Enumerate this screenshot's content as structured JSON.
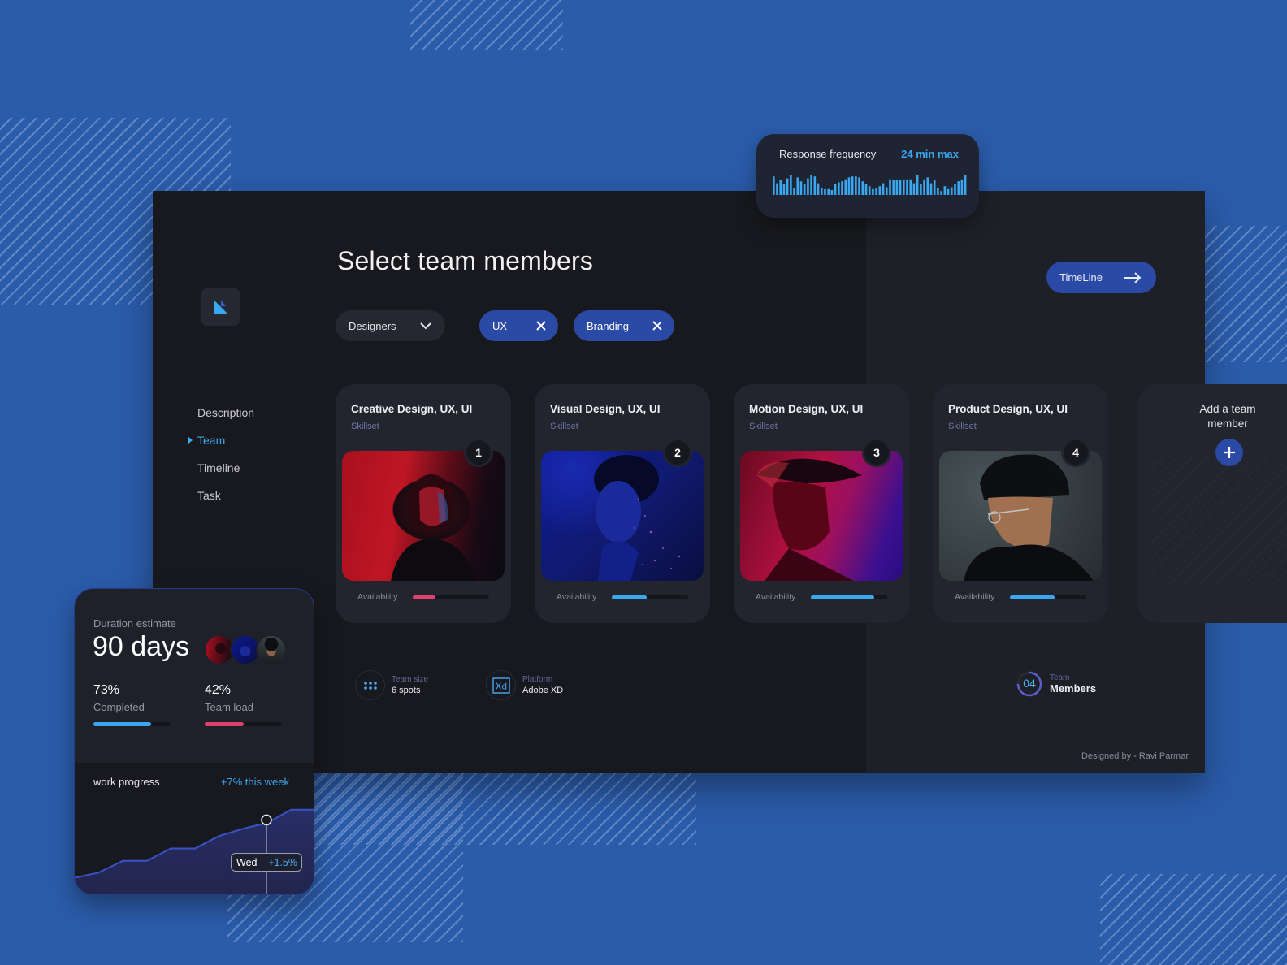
{
  "colors": {
    "background": "#2b5caa",
    "window": "#18191e",
    "card": "#23252e",
    "accent_blue": "#2a4aa5",
    "highlight": "#3aa7f0",
    "pink": "#e0406e"
  },
  "page": {
    "title": "Select team members",
    "credit": "Designed by - Ravi Parmar"
  },
  "logo": {
    "icon": "triangle-logo-icon"
  },
  "filters": {
    "dropdown": {
      "value": "Designers",
      "icon": "chevron-down-icon"
    },
    "chips": [
      {
        "label": "UX",
        "icon": "close-icon"
      },
      {
        "label": "Branding",
        "icon": "close-icon"
      }
    ]
  },
  "timeline_button": {
    "label": "TimeLine",
    "icon": "arrow-right-icon"
  },
  "sidebar": {
    "items": [
      {
        "label": "Description",
        "active": false
      },
      {
        "label": "Team",
        "active": true
      },
      {
        "label": "Timeline",
        "active": false
      },
      {
        "label": "Task",
        "active": false
      }
    ]
  },
  "cards": [
    {
      "title": "Creative Design, UX, UI",
      "subtitle": "Skillset",
      "number": "1",
      "availability_label": "Availability",
      "availability": 0.3,
      "bar_color": "#e0406e",
      "photo": "red-lit-portrait"
    },
    {
      "title": "Visual Design, UX, UI",
      "subtitle": "Skillset",
      "number": "2",
      "availability_label": "Availability",
      "availability": 0.46,
      "bar_color": "#3aa7f0",
      "photo": "blue-glitter-portrait"
    },
    {
      "title": "Motion Design, UX, UI",
      "subtitle": "Skillset",
      "number": "3",
      "availability_label": "Availability",
      "availability": 0.83,
      "bar_color": "#3aa7f0",
      "photo": "magenta-cap-portrait"
    },
    {
      "title": "Product Design, UX, UI",
      "subtitle": "Skillset",
      "number": "4",
      "availability_label": "Availability",
      "availability": 0.58,
      "bar_color": "#3aa7f0",
      "photo": "beanie-glasses-portrait"
    }
  ],
  "add_card": {
    "label": "Add a team member",
    "icon": "plus-icon"
  },
  "meta": {
    "team_size": {
      "label": "Team size",
      "value": "6 spots",
      "icon": "dots-grid-icon"
    },
    "platform": {
      "label": "Platform",
      "value": "Adobe XD",
      "icon": "xd-icon"
    },
    "members": {
      "count": "04",
      "label": "Team",
      "value": "Members",
      "progress": 0.75
    }
  },
  "response_frequency": {
    "title": "Response frequency",
    "max_label": "24 min max",
    "bars": [
      0.95,
      0.6,
      0.75,
      0.55,
      0.85,
      1.0,
      0.35,
      0.9,
      0.7,
      0.55,
      0.85,
      1.0,
      0.95,
      0.6,
      0.35,
      0.3,
      0.3,
      0.25,
      0.55,
      0.65,
      0.7,
      0.8,
      0.9,
      0.95,
      0.95,
      0.9,
      0.7,
      0.55,
      0.45,
      0.3,
      0.35,
      0.45,
      0.6,
      0.4,
      0.8,
      0.75,
      0.75,
      0.75,
      0.8,
      0.8,
      0.8,
      0.6,
      1.0,
      0.55,
      0.8,
      0.9,
      0.6,
      0.75,
      0.35,
      0.2,
      0.45,
      0.3,
      0.4,
      0.55,
      0.7,
      0.8,
      1.0
    ]
  },
  "stats": {
    "duration_label": "Duration estimate",
    "duration_value": "90 days",
    "completed_value": "73%",
    "completed_label": "Completed",
    "completed": 0.75,
    "team_load_value": "42%",
    "team_load_label": "Team load",
    "team_load": 0.5,
    "work_progress_label": "work progress",
    "work_progress_delta": "+7% this week",
    "tooltip_day": "Wed",
    "tooltip_value": "+1.5%",
    "progress_series": [
      0.05,
      0.12,
      0.28,
      0.28,
      0.45,
      0.45,
      0.62,
      0.72,
      0.8,
      0.98,
      0.98
    ]
  }
}
